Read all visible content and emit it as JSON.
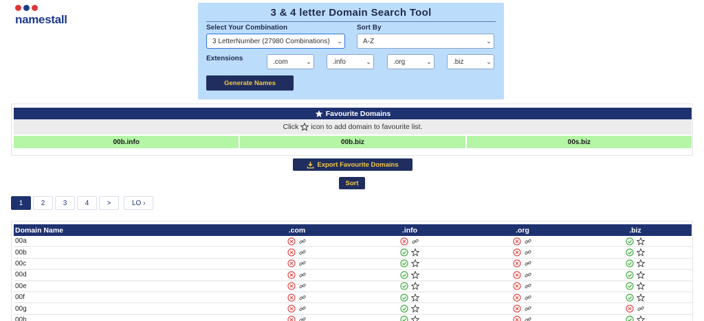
{
  "logo": {
    "part1": "name",
    "part2": "stall",
    "dot_colors": [
      "#d93a3a",
      "#1d3b8c",
      "#d93a3a"
    ]
  },
  "tool": {
    "title": "3 & 4 letter Domain Search Tool",
    "combination_label": "Select Your Combination",
    "combination_value": "3 LetterNumber (27980 Combinations)",
    "sort_label": "Sort By",
    "sort_value": "A-Z",
    "extensions_label": "Extensions",
    "extensions": [
      ".com",
      ".info",
      ".org",
      ".biz"
    ],
    "generate_label": "Generate Names"
  },
  "favourites": {
    "title": "Favourite Domains",
    "hint_before": "Click",
    "hint_after": "icon to add domain to favourite list.",
    "items": [
      "00b.info",
      "00b.biz",
      "00s.biz"
    ]
  },
  "export_label": "Export Favourite Domains",
  "sort_button_label": "Sort",
  "pagination": [
    "1",
    "2",
    "3",
    "4",
    ">",
    "LO ›"
  ],
  "table": {
    "headers": [
      "Domain Name",
      ".com",
      ".info",
      ".org",
      ".biz"
    ],
    "rows": [
      {
        "name": "00a",
        "status": [
          "taken",
          "taken",
          "taken",
          "available"
        ]
      },
      {
        "name": "00b",
        "status": [
          "taken",
          "available",
          "taken",
          "available"
        ]
      },
      {
        "name": "00c",
        "status": [
          "taken",
          "available",
          "taken",
          "available"
        ]
      },
      {
        "name": "00d",
        "status": [
          "taken",
          "available",
          "taken",
          "available"
        ]
      },
      {
        "name": "00e",
        "status": [
          "taken",
          "available",
          "taken",
          "available"
        ]
      },
      {
        "name": "00f",
        "status": [
          "taken",
          "available",
          "taken",
          "available"
        ]
      },
      {
        "name": "00g",
        "status": [
          "taken",
          "available",
          "taken",
          "taken"
        ]
      },
      {
        "name": "00h",
        "status": [
          "taken",
          "available",
          "taken",
          "available"
        ]
      }
    ]
  },
  "colors": {
    "navy": "#1f3270",
    "gold": "#f5c845",
    "taken_red": "#e04a4a",
    "available_green": "#3fae3f",
    "favourite_green": "#b4f5a6",
    "panel_blue": "#bcdcfb"
  }
}
